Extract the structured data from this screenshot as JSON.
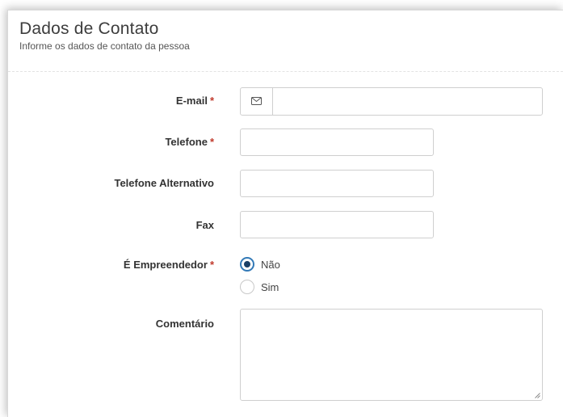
{
  "header": {
    "title": "Dados de Contato",
    "subtitle": "Informe os dados de contato da pessoa"
  },
  "form": {
    "required_mark": "*",
    "email": {
      "label": "E-mail",
      "icon": "envelope-icon",
      "value": ""
    },
    "telefone": {
      "label": "Telefone",
      "value": ""
    },
    "telefone_alt": {
      "label": "Telefone Alternativo",
      "value": ""
    },
    "fax": {
      "label": "Fax",
      "value": ""
    },
    "empreendedor": {
      "label": "É Empreendedor",
      "options": [
        {
          "label": "Não",
          "selected": true
        },
        {
          "label": "Sim",
          "selected": false
        }
      ]
    },
    "comentario": {
      "label": "Comentário",
      "value": ""
    }
  },
  "colors": {
    "required": "#c0392b",
    "radio_selected": "#337ab7"
  }
}
